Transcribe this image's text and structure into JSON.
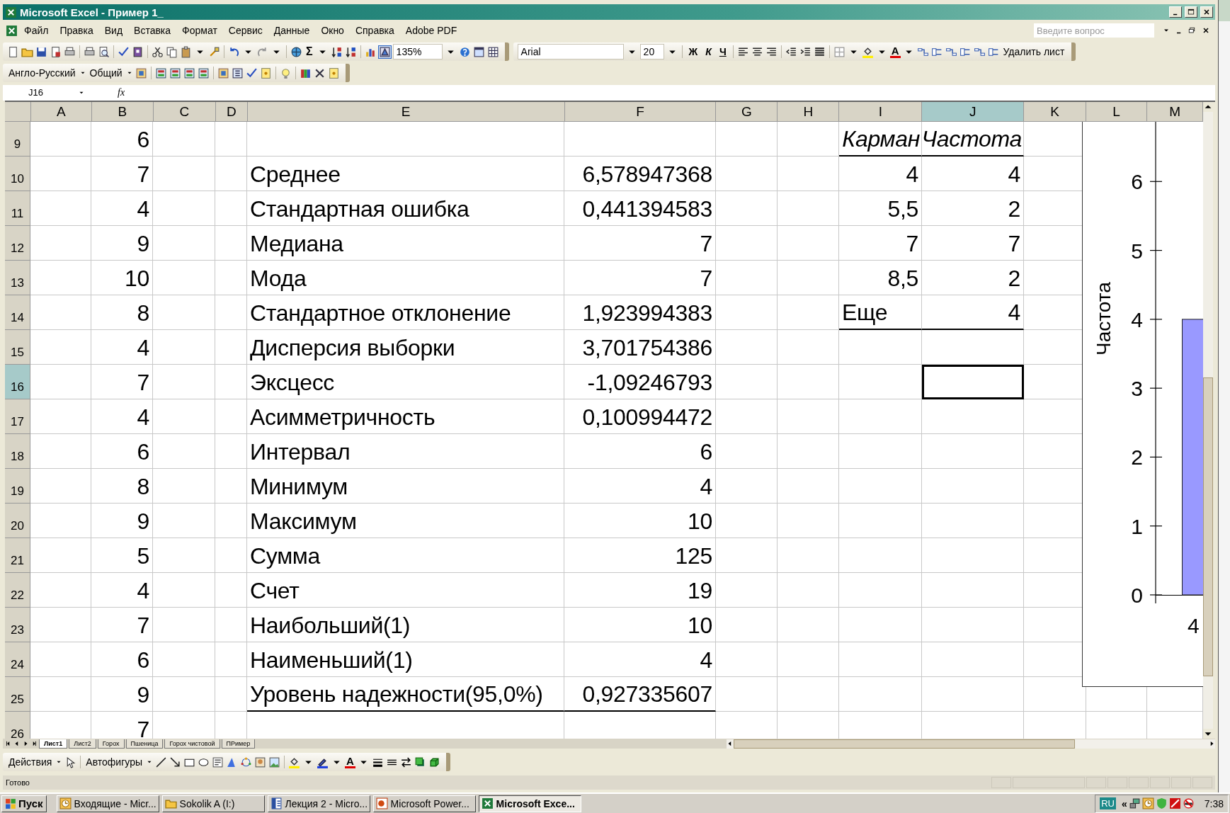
{
  "window": {
    "title": "Microsoft Excel - Пример 1_"
  },
  "menu": [
    "Файл",
    "Правка",
    "Вид",
    "Вставка",
    "Формат",
    "Сервис",
    "Данные",
    "Окно",
    "Справка",
    "Adobe PDF"
  ],
  "help_search": {
    "placeholder": "Введите вопрос"
  },
  "standard_toolbar": {
    "autosum": "Σ",
    "zoom": "135%"
  },
  "formatting_toolbar": {
    "font": "Arial",
    "size": "20",
    "style_buttons": [
      "Ж",
      "К",
      "Ч"
    ],
    "font_color": "A",
    "delete_sheet": "Удалить лист"
  },
  "translate_toolbar": {
    "dictionary": "Англо-Русский",
    "mode": "Общий"
  },
  "formula_bar": {
    "name_box": "J16",
    "function_label": "fx"
  },
  "columns": [
    {
      "label": "A",
      "selected": false
    },
    {
      "label": "B",
      "selected": false
    },
    {
      "label": "C",
      "selected": false
    },
    {
      "label": "D",
      "selected": false
    },
    {
      "label": "E",
      "selected": false
    },
    {
      "label": "F",
      "selected": false
    },
    {
      "label": "G",
      "selected": false
    },
    {
      "label": "H",
      "selected": false
    },
    {
      "label": "I",
      "selected": false
    },
    {
      "label": "J",
      "selected": true
    },
    {
      "label": "K",
      "selected": false
    },
    {
      "label": "L",
      "selected": false
    },
    {
      "label": "M",
      "selected": false
    }
  ],
  "rows": [
    {
      "number": "9",
      "selected": false,
      "b": {
        "text": "6",
        "kind": "number",
        "bottom_border": false
      },
      "i": {
        "text": "Карман",
        "kind": "header",
        "bottom_border": true
      },
      "j": {
        "text": "Частота",
        "kind": "header",
        "bottom_border": true
      }
    },
    {
      "number": "10",
      "selected": false,
      "b": {
        "text": "7",
        "kind": "number",
        "bottom_border": false
      },
      "e": {
        "text": "Среднее",
        "kind": "text",
        "bottom_border": false
      },
      "f": {
        "text": "6,578947368",
        "kind": "number",
        "bottom_border": false
      },
      "i": {
        "text": "4",
        "kind": "number",
        "bottom_border": false
      },
      "j": {
        "text": "4",
        "kind": "number",
        "bottom_border": false
      }
    },
    {
      "number": "11",
      "selected": false,
      "b": {
        "text": "4",
        "kind": "number",
        "bottom_border": false
      },
      "e": {
        "text": "Стандартная ошибка",
        "kind": "text",
        "bottom_border": false
      },
      "f": {
        "text": "0,441394583",
        "kind": "number",
        "bottom_border": false
      },
      "i": {
        "text": "5,5",
        "kind": "number",
        "bottom_border": false
      },
      "j": {
        "text": "2",
        "kind": "number",
        "bottom_border": false
      }
    },
    {
      "number": "12",
      "selected": false,
      "b": {
        "text": "9",
        "kind": "number",
        "bottom_border": false
      },
      "e": {
        "text": "Медиана",
        "kind": "text",
        "bottom_border": false
      },
      "f": {
        "text": "7",
        "kind": "number",
        "bottom_border": false
      },
      "i": {
        "text": "7",
        "kind": "number",
        "bottom_border": false
      },
      "j": {
        "text": "7",
        "kind": "number",
        "bottom_border": false
      }
    },
    {
      "number": "13",
      "selected": false,
      "b": {
        "text": "10",
        "kind": "number",
        "bottom_border": false
      },
      "e": {
        "text": "Мода",
        "kind": "text",
        "bottom_border": false
      },
      "f": {
        "text": "7",
        "kind": "number",
        "bottom_border": false
      },
      "i": {
        "text": "8,5",
        "kind": "number",
        "bottom_border": false
      },
      "j": {
        "text": "2",
        "kind": "number",
        "bottom_border": false
      }
    },
    {
      "number": "14",
      "selected": false,
      "b": {
        "text": "8",
        "kind": "number",
        "bottom_border": false
      },
      "e": {
        "text": "Стандартное отклонение",
        "kind": "text",
        "bottom_border": false
      },
      "f": {
        "text": "1,923994383",
        "kind": "number",
        "bottom_border": false
      },
      "i": {
        "text": "Еще",
        "kind": "text",
        "bottom_border": true
      },
      "j": {
        "text": "4",
        "kind": "number",
        "bottom_border": true
      }
    },
    {
      "number": "15",
      "selected": false,
      "b": {
        "text": "4",
        "kind": "number",
        "bottom_border": false
      },
      "e": {
        "text": "Дисперсия выборки",
        "kind": "text",
        "bottom_border": false
      },
      "f": {
        "text": "3,701754386",
        "kind": "number",
        "bottom_border": false
      }
    },
    {
      "number": "16",
      "selected": true,
      "b": {
        "text": "7",
        "kind": "number",
        "bottom_border": false
      },
      "e": {
        "text": "Эксцесс",
        "kind": "text",
        "bottom_border": false
      },
      "f": {
        "text": "-1,09246793",
        "kind": "number",
        "bottom_border": false
      }
    },
    {
      "number": "17",
      "selected": false,
      "b": {
        "text": "4",
        "kind": "number",
        "bottom_border": false
      },
      "e": {
        "text": "Асимметричность",
        "kind": "text",
        "bottom_border": false
      },
      "f": {
        "text": "0,100994472",
        "kind": "number",
        "bottom_border": false
      }
    },
    {
      "number": "18",
      "selected": false,
      "b": {
        "text": "6",
        "kind": "number",
        "bottom_border": false
      },
      "e": {
        "text": "Интервал",
        "kind": "text",
        "bottom_border": false
      },
      "f": {
        "text": "6",
        "kind": "number",
        "bottom_border": false
      }
    },
    {
      "number": "19",
      "selected": false,
      "b": {
        "text": "8",
        "kind": "number",
        "bottom_border": false
      },
      "e": {
        "text": "Минимум",
        "kind": "text",
        "bottom_border": false
      },
      "f": {
        "text": "4",
        "kind": "number",
        "bottom_border": false
      }
    },
    {
      "number": "20",
      "selected": false,
      "b": {
        "text": "9",
        "kind": "number",
        "bottom_border": false
      },
      "e": {
        "text": "Максимум",
        "kind": "text",
        "bottom_border": false
      },
      "f": {
        "text": "10",
        "kind": "number",
        "bottom_border": false
      }
    },
    {
      "number": "21",
      "selected": false,
      "b": {
        "text": "5",
        "kind": "number",
        "bottom_border": false
      },
      "e": {
        "text": "Сумма",
        "kind": "text",
        "bottom_border": false
      },
      "f": {
        "text": "125",
        "kind": "number",
        "bottom_border": false
      }
    },
    {
      "number": "22",
      "selected": false,
      "b": {
        "text": "4",
        "kind": "number",
        "bottom_border": false
      },
      "e": {
        "text": "Счет",
        "kind": "text",
        "bottom_border": false
      },
      "f": {
        "text": "19",
        "kind": "number",
        "bottom_border": false
      }
    },
    {
      "number": "23",
      "selected": false,
      "b": {
        "text": "7",
        "kind": "number",
        "bottom_border": false
      },
      "e": {
        "text": "Наибольший(1)",
        "kind": "text",
        "bottom_border": false
      },
      "f": {
        "text": "10",
        "kind": "number",
        "bottom_border": false
      }
    },
    {
      "number": "24",
      "selected": false,
      "b": {
        "text": "6",
        "kind": "number",
        "bottom_border": false
      },
      "e": {
        "text": "Наименьший(1)",
        "kind": "text",
        "bottom_border": false
      },
      "f": {
        "text": "4",
        "kind": "number",
        "bottom_border": false
      }
    },
    {
      "number": "25",
      "selected": false,
      "b": {
        "text": "9",
        "kind": "number",
        "bottom_border": false
      },
      "e": {
        "text": "Уровень надежности(95,0%)",
        "kind": "text",
        "bottom_border": true
      },
      "f": {
        "text": "0,927335607",
        "kind": "number",
        "bottom_border": true
      }
    },
    {
      "number": "26",
      "selected": false,
      "b": {
        "text": "7",
        "kind": "number",
        "bottom_border": false
      }
    }
  ],
  "chart": {
    "chart_data": {
      "type": "bar",
      "ylabel": "Частота",
      "categories": [
        "4"
      ],
      "ylim": [
        0,
        7
      ],
      "yticks": [
        0,
        1,
        2,
        3,
        4,
        5,
        6
      ],
      "series": [
        {
          "color": "#9999ff",
          "values": [
            4
          ]
        }
      ]
    }
  },
  "sheet_tabs": [
    {
      "label": "Лист1",
      "selected": true
    },
    {
      "label": "Лист2",
      "selected": false
    },
    {
      "label": "Горох",
      "selected": false
    },
    {
      "label": "Пшеница",
      "selected": false
    },
    {
      "label": "Горох чистовой",
      "selected": false
    },
    {
      "label": "ПРимер",
      "selected": false
    }
  ],
  "drawing_toolbar": {
    "actions": "Действия",
    "autoshapes": "Автофигуры",
    "font_color": "A"
  },
  "status_bar": {
    "text": "Готово"
  },
  "taskbar": {
    "start": "Пуск",
    "items": [
      {
        "label": "Входящие - Micr...",
        "selected": false
      },
      {
        "label": "Sokolik A (I:)",
        "selected": false
      },
      {
        "label": "Лекция 2 - Micro...",
        "selected": false
      },
      {
        "label": "Microsoft Power...",
        "selected": false
      },
      {
        "label": "Microsoft Exce...",
        "selected": true
      }
    ],
    "language": "RU",
    "tray_expand": "«",
    "time": "7:38"
  }
}
